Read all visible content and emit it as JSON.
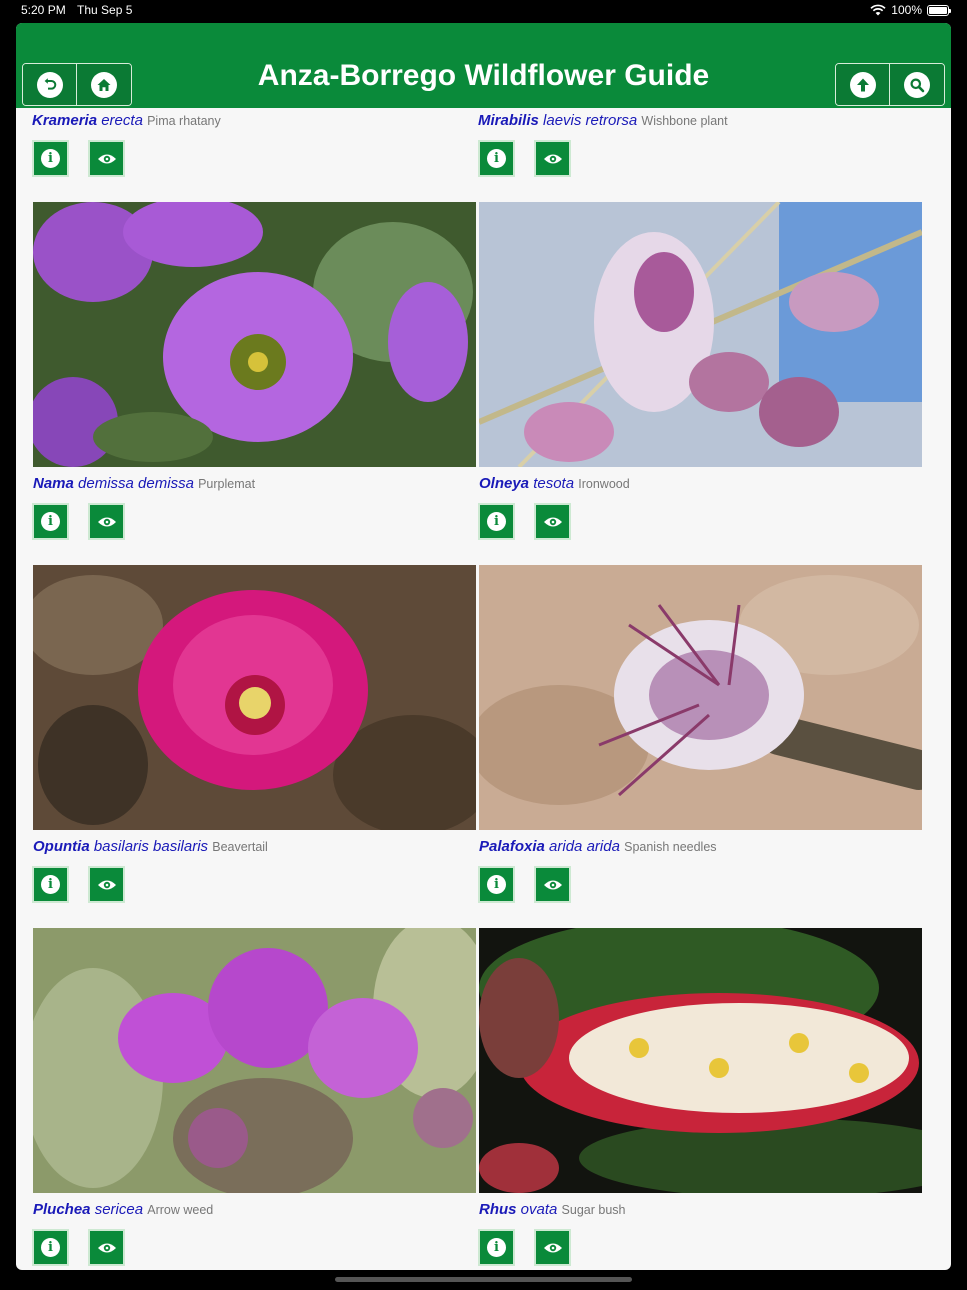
{
  "status": {
    "time": "5:20 PM",
    "date": "Thu Sep 5",
    "battery": "100%"
  },
  "header": {
    "title": "Anza-Borrego Wildflower Guide"
  },
  "icons": {
    "back": "undo-icon",
    "home": "home-icon",
    "up": "arrow-up-icon",
    "search": "search-icon",
    "info": "info-icon",
    "view": "eye-icon"
  },
  "top_row": [
    {
      "genus": "Krameria",
      "species": "erecta",
      "common": "Pima rhatany"
    },
    {
      "genus": "Mirabilis",
      "species": "laevis retrorsa",
      "common": "Wishbone plant"
    }
  ],
  "rows": [
    [
      {
        "genus": "Nama",
        "species": "demissa demissa",
        "common": "Purplemat"
      },
      {
        "genus": "Olneya",
        "species": "tesota",
        "common": "Ironwood"
      }
    ],
    [
      {
        "genus": "Opuntia",
        "species": "basilaris basilaris",
        "common": "Beavertail"
      },
      {
        "genus": "Palafoxia",
        "species": "arida arida",
        "common": "Spanish needles"
      }
    ],
    [
      {
        "genus": "Pluchea",
        "species": "sericea",
        "common": "Arrow weed"
      },
      {
        "genus": "Rhus",
        "species": "ovata",
        "common": "Sugar bush"
      }
    ]
  ],
  "colors": {
    "header_green": "#0a8a3a",
    "name_blue": "#1a1ab8",
    "common_gray": "#777777"
  }
}
